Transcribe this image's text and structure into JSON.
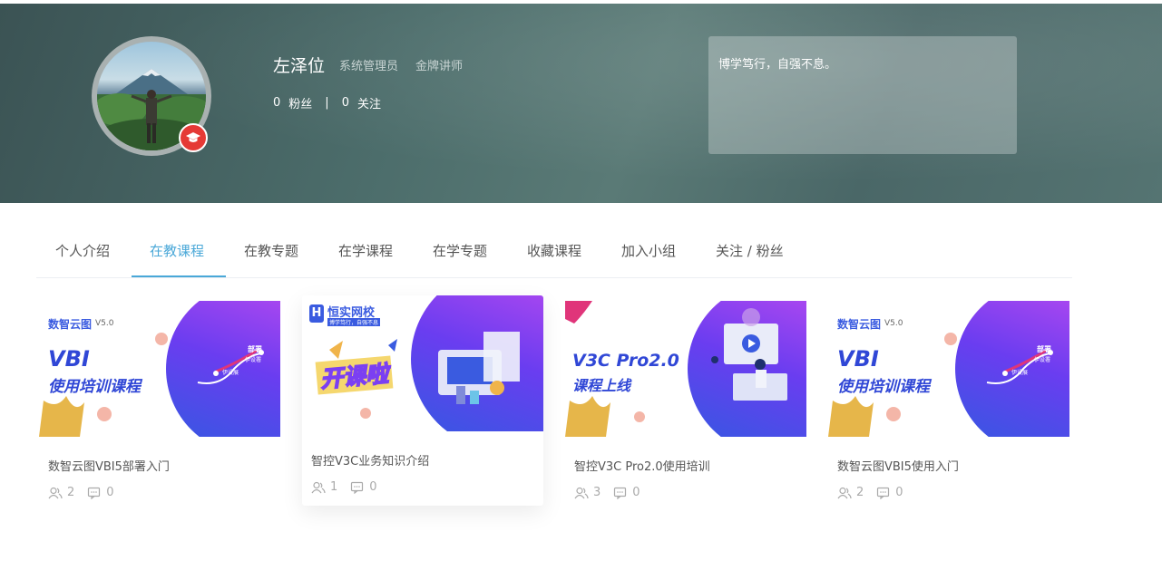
{
  "profile": {
    "name": "左泽位",
    "roles": [
      "系统管理员",
      "金牌讲师"
    ],
    "fans_count": "0",
    "fans_label": "粉丝",
    "follow_count": "0",
    "follow_label": "关注",
    "separator": "|",
    "motto": "博学笃行，自强不息。"
  },
  "tabs": [
    {
      "label": "个人介绍"
    },
    {
      "label": "在教课程"
    },
    {
      "label": "在教专题"
    },
    {
      "label": "在学课程"
    },
    {
      "label": "在学专题"
    },
    {
      "label": "收藏课程"
    },
    {
      "label": "加入小组"
    },
    {
      "label": "关注 / 粉丝"
    }
  ],
  "active_tab": "在教课程",
  "courses": [
    {
      "title": "数智云图VBI5部署入门",
      "students": "2",
      "comments": "0",
      "thumb": {
        "brand": "数智云图",
        "version": "V5.0",
        "line1": "VBI",
        "line2": "使用培训课程",
        "p1": "伊设展",
        "p2": "伊设署",
        "p3": "部署"
      }
    },
    {
      "title": "智控V3C业务知识介绍",
      "students": "1",
      "comments": "0",
      "thumb": {
        "brand": "恒实网校",
        "tagline": "博学笃行，自强不息",
        "main": "开课啦"
      }
    },
    {
      "title": "智控V3C Pro2.0使用培训",
      "students": "3",
      "comments": "0",
      "thumb": {
        "line1": "V3C Pro2.0",
        "line2": "课程上线"
      }
    },
    {
      "title": "数智云图VBI5使用入门",
      "students": "2",
      "comments": "0",
      "thumb": {
        "brand": "数智云图",
        "version": "V5.0",
        "line1": "VBI",
        "line2": "使用培训课程",
        "p1": "伊设展",
        "p2": "伊设署",
        "p3": "部署"
      }
    }
  ],
  "colors": {
    "accent": "#4aa8d8",
    "badge": "#e53935",
    "thumb_purple": "#7b3ff2",
    "thumb_blue": "#3a5be0"
  },
  "icons": {
    "badge": "graduation-cap-icon",
    "students": "users-icon",
    "comments": "comment-icon"
  }
}
